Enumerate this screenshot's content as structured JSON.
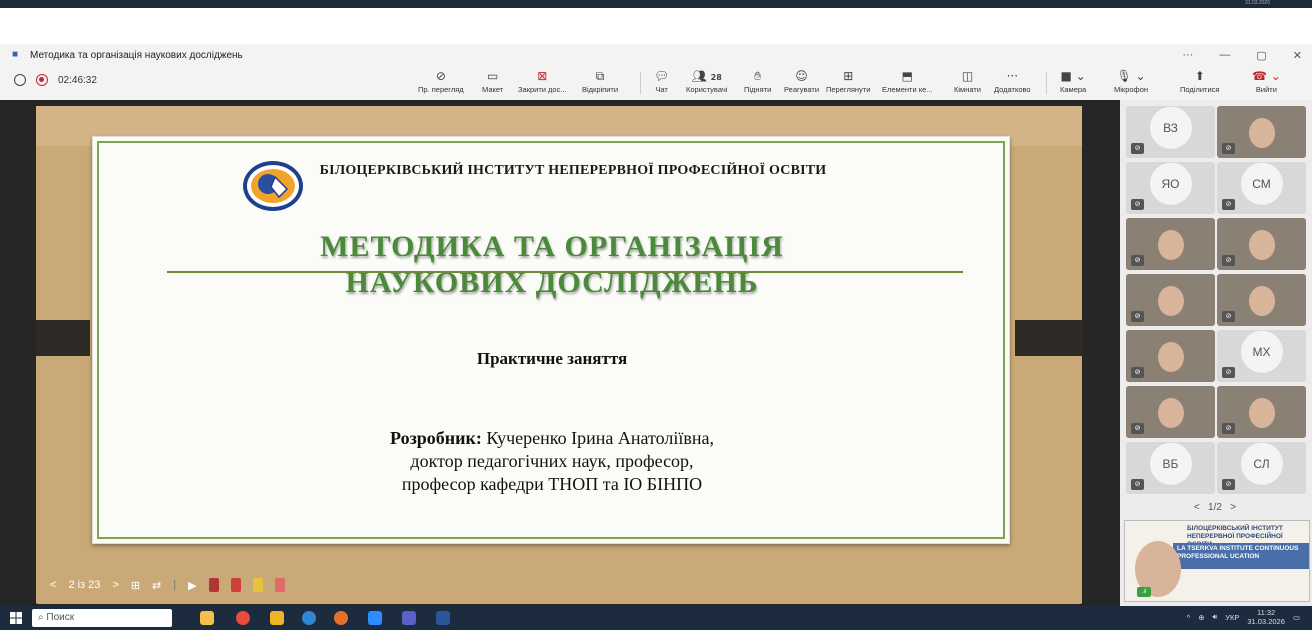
{
  "window": {
    "title": "Методика та організація наукових досліджень"
  },
  "top_strip_clock": "31.03.2026",
  "recording": {
    "time": "02:46:32"
  },
  "toolbar": {
    "items": [
      {
        "label": "Пр. перегляд",
        "icon": "eye-off-icon"
      },
      {
        "label": "Макет",
        "icon": "layout-icon"
      },
      {
        "label": "Закрити дос...",
        "icon": "close-doc-icon"
      },
      {
        "label": "Відкріпити",
        "icon": "unpin-icon"
      },
      {
        "label": "Чат",
        "icon": "chat-icon"
      },
      {
        "label": "Користувачі",
        "icon": "people-icon",
        "badge": "28"
      },
      {
        "label": "Підняти",
        "icon": "raise-hand-icon"
      },
      {
        "label": "Реагувати",
        "icon": "react-icon"
      },
      {
        "label": "Переглянути",
        "icon": "view-icon"
      },
      {
        "label": "Елементи ке...",
        "icon": "apps-icon"
      },
      {
        "label": "Кімнати",
        "icon": "rooms-icon"
      },
      {
        "label": "Додатково",
        "icon": "more-icon"
      },
      {
        "label": "Камера",
        "icon": "camera-icon"
      },
      {
        "label": "Мікрофон",
        "icon": "mic-icon"
      },
      {
        "label": "Поділитися",
        "icon": "share-icon"
      },
      {
        "label": "Вийти",
        "icon": "leave-icon"
      }
    ]
  },
  "slide": {
    "institution": "БІЛОЦЕРКІВСЬКИЙ ІНСТИТУТ НЕПЕРЕРВНОЇ ПРОФЕСІЙНОЇ ОСВІТИ",
    "title_line1": "МЕТОДИКА ТА ОРГАНІЗАЦІЯ",
    "title_line2": "НАУКОВИХ ДОСЛІДЖЕНЬ",
    "subtitle": "Практичне заняття",
    "author_label": "Розробник:",
    "author_name": " Кучеренко Ірина Анатоліївна,",
    "author_line2": "доктор педагогічних наук, професор,",
    "author_line3": "професор кафедри ТНОП та ІО  БІНПО"
  },
  "slide_nav": {
    "page": "2 із 23"
  },
  "participants": [
    {
      "initials": "ВЗ",
      "photo": false
    },
    {
      "initials": "",
      "photo": true
    },
    {
      "initials": "ЯО",
      "photo": false
    },
    {
      "initials": "СМ",
      "photo": false
    },
    {
      "initials": "",
      "photo": true
    },
    {
      "initials": "",
      "photo": true
    },
    {
      "initials": "",
      "photo": true
    },
    {
      "initials": "",
      "photo": true
    },
    {
      "initials": "",
      "photo": true
    },
    {
      "initials": "МХ",
      "photo": false
    },
    {
      "initials": "",
      "photo": true
    },
    {
      "initials": "",
      "photo": true
    },
    {
      "initials": "ВБ",
      "photo": false
    },
    {
      "initials": "СЛ",
      "photo": false
    }
  ],
  "gallery_pager": "1/2",
  "self_view": {
    "line1": "БІЛОЦЕРКІВСЬКИЙ ІНСТИТУТ",
    "line2": "НЕПЕРЕРВНОЇ ПРОФЕСІЙНОЇ ОСВІТИ",
    "band": "LA TSERKVA INSTITUTE CONTINUOUS PROFESSIONAL UCATION"
  },
  "taskbar": {
    "search_placeholder": "Поиск",
    "lang": "УКР",
    "time": "11:32",
    "date": "31.03.2026"
  },
  "colors": {
    "accent_green": "#4a8a3a",
    "record_red": "#c0282d",
    "leave_red": "#c0282d",
    "taskbar": "#1c2b3e"
  }
}
